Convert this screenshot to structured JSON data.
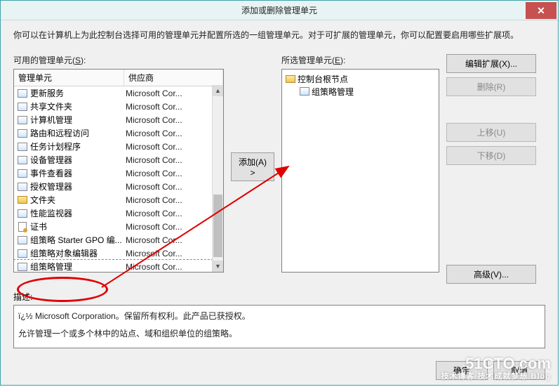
{
  "dialog": {
    "title": "添加或删除管理单元",
    "close_glyph": "✕",
    "intro": "你可以在计算机上为此控制台选择可用的管理单元并配置所选的一组管理单元。对于可扩展的管理单元，你可以配置要启用哪些扩展项。"
  },
  "available": {
    "label_pre": "可用的管理单元(",
    "label_key": "S",
    "label_post": "):",
    "col_name": "管理单元",
    "col_vendor": "供应商",
    "items": [
      {
        "name": "更新服务",
        "vendor": "Microsoft Cor..."
      },
      {
        "name": "共享文件夹",
        "vendor": "Microsoft Cor..."
      },
      {
        "name": "计算机管理",
        "vendor": "Microsoft Cor..."
      },
      {
        "name": "路由和远程访问",
        "vendor": "Microsoft Cor..."
      },
      {
        "name": "任务计划程序",
        "vendor": "Microsoft Cor..."
      },
      {
        "name": "设备管理器",
        "vendor": "Microsoft Cor..."
      },
      {
        "name": "事件查看器",
        "vendor": "Microsoft Cor..."
      },
      {
        "name": "授权管理器",
        "vendor": "Microsoft Cor..."
      },
      {
        "name": "文件夹",
        "vendor": "Microsoft Cor..."
      },
      {
        "name": "性能监视器",
        "vendor": "Microsoft Cor..."
      },
      {
        "name": "证书",
        "vendor": "Microsoft Cor..."
      },
      {
        "name": "组策略 Starter GPO 编...",
        "vendor": "Microsoft Cor..."
      },
      {
        "name": "组策略对象编辑器",
        "vendor": "Microsoft Cor..."
      },
      {
        "name": "组策略管理",
        "vendor": "Microsoft Cor...",
        "selected": true
      }
    ]
  },
  "add_btn": "添加(A) >",
  "selected": {
    "label_pre": "所选管理单元(",
    "label_key": "E",
    "label_post": "):",
    "root": "控制台根节点",
    "child": "组策略管理"
  },
  "right_btns": {
    "edit_ext": "编辑扩展(X)...",
    "remove": "删除(R)",
    "move_up": "上移(U)",
    "move_dn": "下移(D)",
    "advanced": "高级(V)..."
  },
  "desc": {
    "label": "描述:",
    "line1": "ï¿½ Microsoft Corporation。保留所有权利。此产品已获授权。",
    "line2": "允许管理一个或多个林中的站点、域和组织单位的组策略。"
  },
  "dlg_btns": {
    "ok": "确定",
    "cancel": "取消"
  },
  "watermark": {
    "l1": "51CTO.com",
    "l2": "技术博客   技术成就梦想 Blog"
  },
  "colors": {
    "accent": "#3fa2a6",
    "close": "#c75050",
    "anno": "#e00000"
  }
}
